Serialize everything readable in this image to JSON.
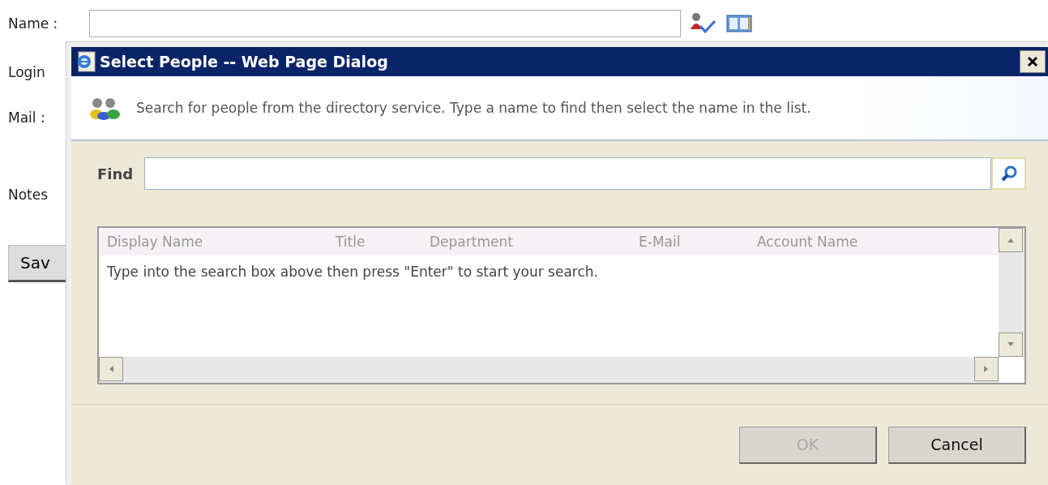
{
  "form": {
    "fields": [
      {
        "label": "Name :",
        "kind": "input"
      },
      {
        "label": "Login",
        "kind": "label"
      },
      {
        "label": "Mail :",
        "kind": "label"
      },
      {
        "label": "Notes",
        "kind": "label"
      }
    ],
    "save_button": "Sav"
  },
  "dialog": {
    "title": "Select People -- Web Page Dialog",
    "instruction": "Search for people from the directory service. Type a name to find then select the name in the list.",
    "find_label": "Find",
    "columns": [
      "Display Name",
      "Title",
      "Department",
      "E-Mail",
      "Account Name"
    ],
    "empty_message": "Type into the search box above then press \"Enter\" to start your search.",
    "buttons": [
      {
        "label": "OK",
        "disabled": true
      },
      {
        "label": "Cancel",
        "disabled": false
      }
    ]
  }
}
